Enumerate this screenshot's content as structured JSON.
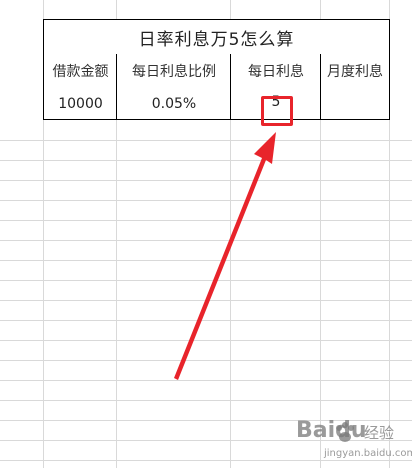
{
  "sheet": {
    "title": "日率利息万5怎么算",
    "headers": [
      "借款金额",
      "每日利息比例",
      "每日利息",
      "月度利息"
    ],
    "row": [
      "10000",
      "0.05%",
      "5",
      ""
    ]
  },
  "annotation": {
    "highlight_color": "#e8242b",
    "arrow_color": "#e8242b"
  },
  "watermark": {
    "brand": "Baidu",
    "product": "经验",
    "url": "jingyan.baidu.com"
  }
}
